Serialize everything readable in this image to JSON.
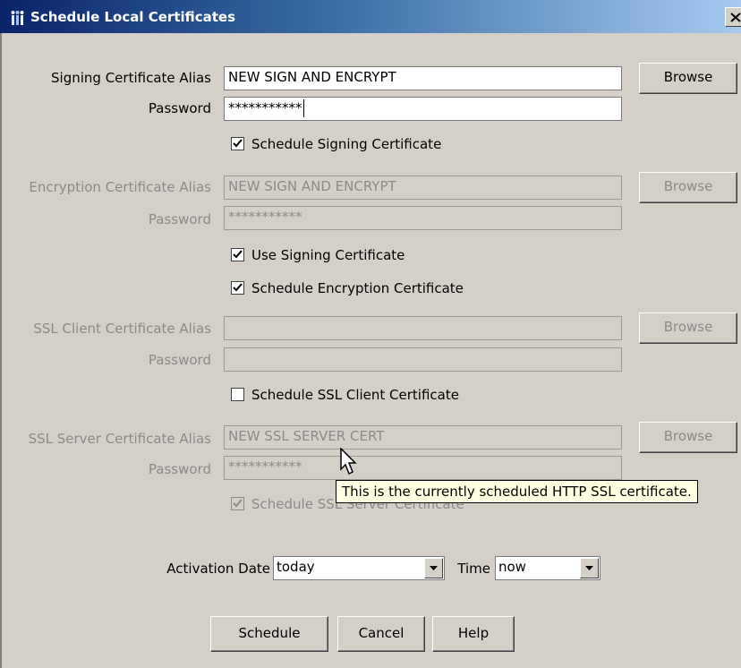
{
  "window": {
    "title": "Schedule Local Certificates",
    "close_glyph": "×"
  },
  "signing": {
    "alias_label": "Signing Certificate Alias",
    "alias_value": "NEW SIGN AND ENCRYPT",
    "browse_label": "Browse",
    "password_label": "Password",
    "password_value": "***********",
    "schedule_label": "Schedule Signing Certificate",
    "schedule_checked": true
  },
  "encryption": {
    "alias_label": "Encryption Certificate Alias",
    "alias_value": "NEW SIGN AND ENCRYPT",
    "browse_label": "Browse",
    "password_label": "Password",
    "password_value": "***********",
    "use_signing_label": "Use Signing Certificate",
    "use_signing_checked": true,
    "schedule_label": "Schedule Encryption Certificate",
    "schedule_checked": true
  },
  "ssl_client": {
    "alias_label": "SSL Client Certificate Alias",
    "alias_value": "",
    "browse_label": "Browse",
    "password_label": "Password",
    "password_value": "",
    "schedule_label": "Schedule SSL Client Certificate",
    "schedule_checked": false
  },
  "ssl_server": {
    "alias_label": "SSL Server Certificate Alias",
    "alias_value": "NEW SSL SERVER CERT",
    "browse_label": "Browse",
    "password_label": "Password",
    "password_value": "***********",
    "schedule_label": "Schedule SSL Server Certificate",
    "schedule_checked": true
  },
  "tooltip": {
    "text": "This is the currently scheduled HTTP SSL certificate."
  },
  "activation": {
    "date_label": "Activation Date",
    "date_value": "today",
    "time_label": "Time",
    "time_value": "now"
  },
  "buttons": {
    "schedule": "Schedule",
    "cancel": "Cancel",
    "help": "Help"
  },
  "colors": {
    "face": "#d4d0c8",
    "title_start": "#0a246a",
    "title_end": "#a6caf0",
    "disabled_text": "#8a8a8a",
    "tooltip_bg": "#ffffe1"
  },
  "icons": [
    "app-icon",
    "close-icon",
    "checkmark-icon",
    "dropdown-arrow-icon",
    "mouse-pointer-icon"
  ]
}
